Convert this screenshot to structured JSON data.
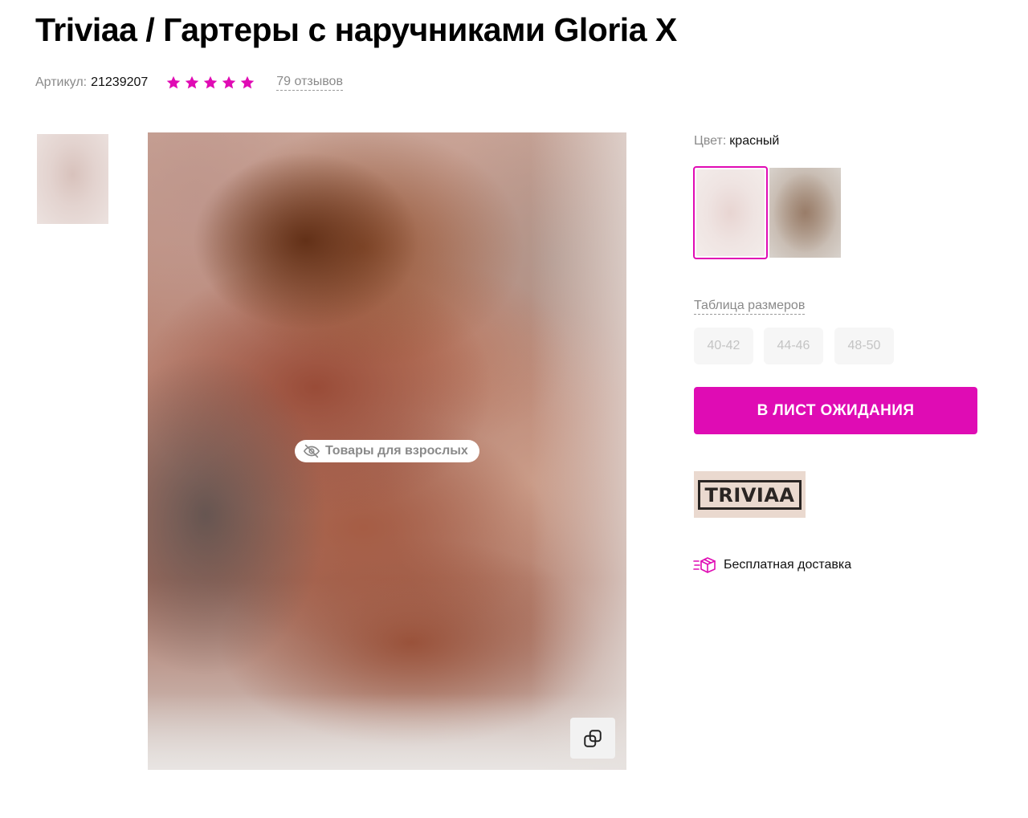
{
  "product": {
    "title": "Triviaa / Гартеры с наручниками Gloria X",
    "article_label": "Артикул:",
    "article_value": "21239207",
    "rating": 5,
    "reviews_label": "79 отзывов"
  },
  "gallery": {
    "adult_badge_text": "Товары для взрослых"
  },
  "options": {
    "color_label": "Цвет:",
    "color_value": "красный",
    "size_table_label": "Таблица размеров",
    "sizes": [
      "40-42",
      "44-46",
      "48-50"
    ]
  },
  "actions": {
    "waitlist_label": "В ЛИСТ ОЖИДАНИЯ"
  },
  "brand": {
    "logo_text": "TRIVIAA"
  },
  "delivery": {
    "text": "Бесплатная доставка",
    "icon": "delivery-box-icon"
  },
  "colors": {
    "accent": "#df0cb4",
    "star": "#e00bb4",
    "muted_text": "#8a8a8a"
  }
}
